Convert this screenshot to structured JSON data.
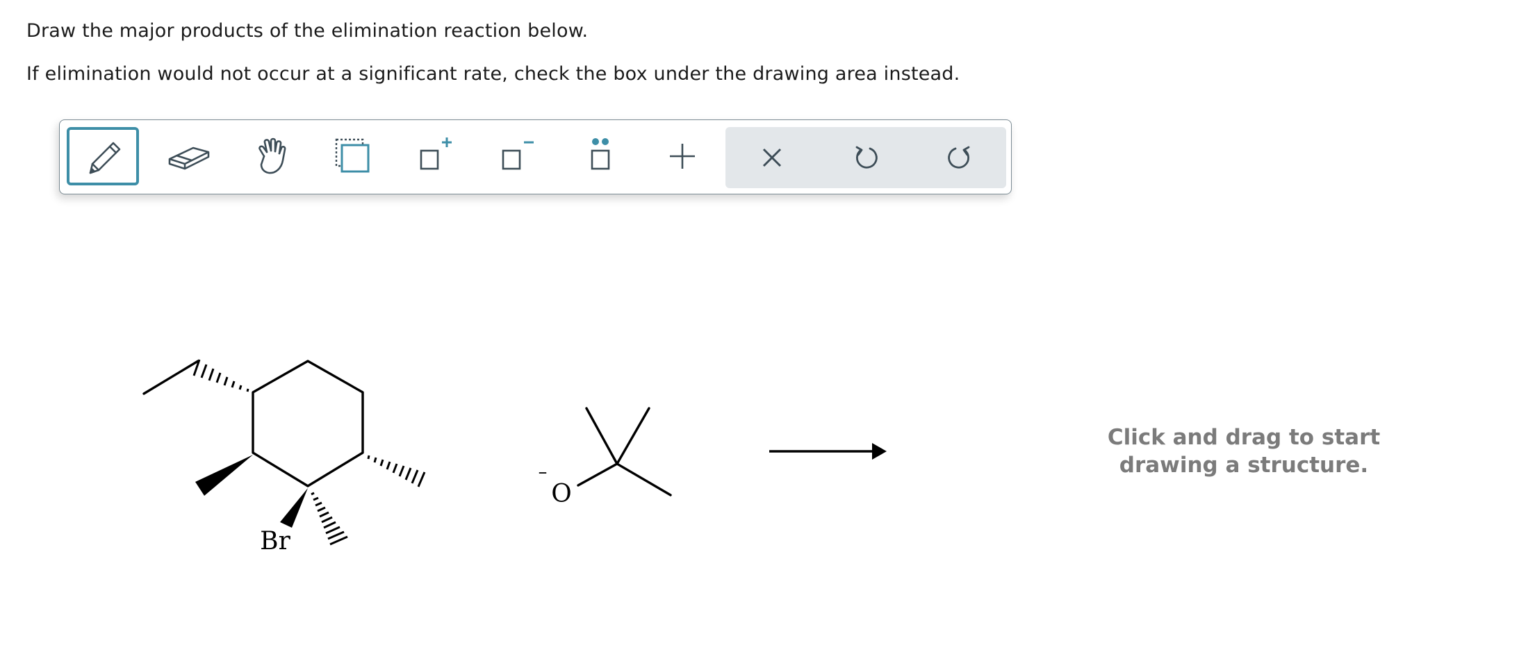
{
  "question": {
    "line1": "Draw the major products of the elimination reaction below.",
    "line2": "If elimination would not occur at a significant rate, check the box under the drawing area instead."
  },
  "toolbar": {
    "tools": [
      {
        "name": "draw",
        "icon": "pencil-icon",
        "active": true
      },
      {
        "name": "erase",
        "icon": "eraser-icon"
      },
      {
        "name": "move",
        "icon": "hand-icon"
      },
      {
        "name": "select",
        "icon": "marquee-select-icon"
      },
      {
        "name": "increase-charge",
        "icon": "charge-plus-icon"
      },
      {
        "name": "decrease-charge",
        "icon": "charge-minus-icon"
      },
      {
        "name": "lone-pair",
        "icon": "lone-pair-icon"
      },
      {
        "name": "add-reagent",
        "icon": "plus-icon"
      }
    ],
    "actions": [
      {
        "name": "clear",
        "icon": "close-icon"
      },
      {
        "name": "undo",
        "icon": "undo-icon"
      },
      {
        "name": "redo",
        "icon": "redo-icon"
      }
    ],
    "colors": {
      "accent": "#3d8ea7",
      "icon": "#3d4d57",
      "action_bg": "#e3e7ea",
      "border": "#7a8a93"
    }
  },
  "reaction": {
    "substrate_label": "Br",
    "base_atom": "O",
    "base_charge": "–"
  },
  "canvas": {
    "hint_line1": "Click and drag to start",
    "hint_line2": "drawing a structure."
  }
}
